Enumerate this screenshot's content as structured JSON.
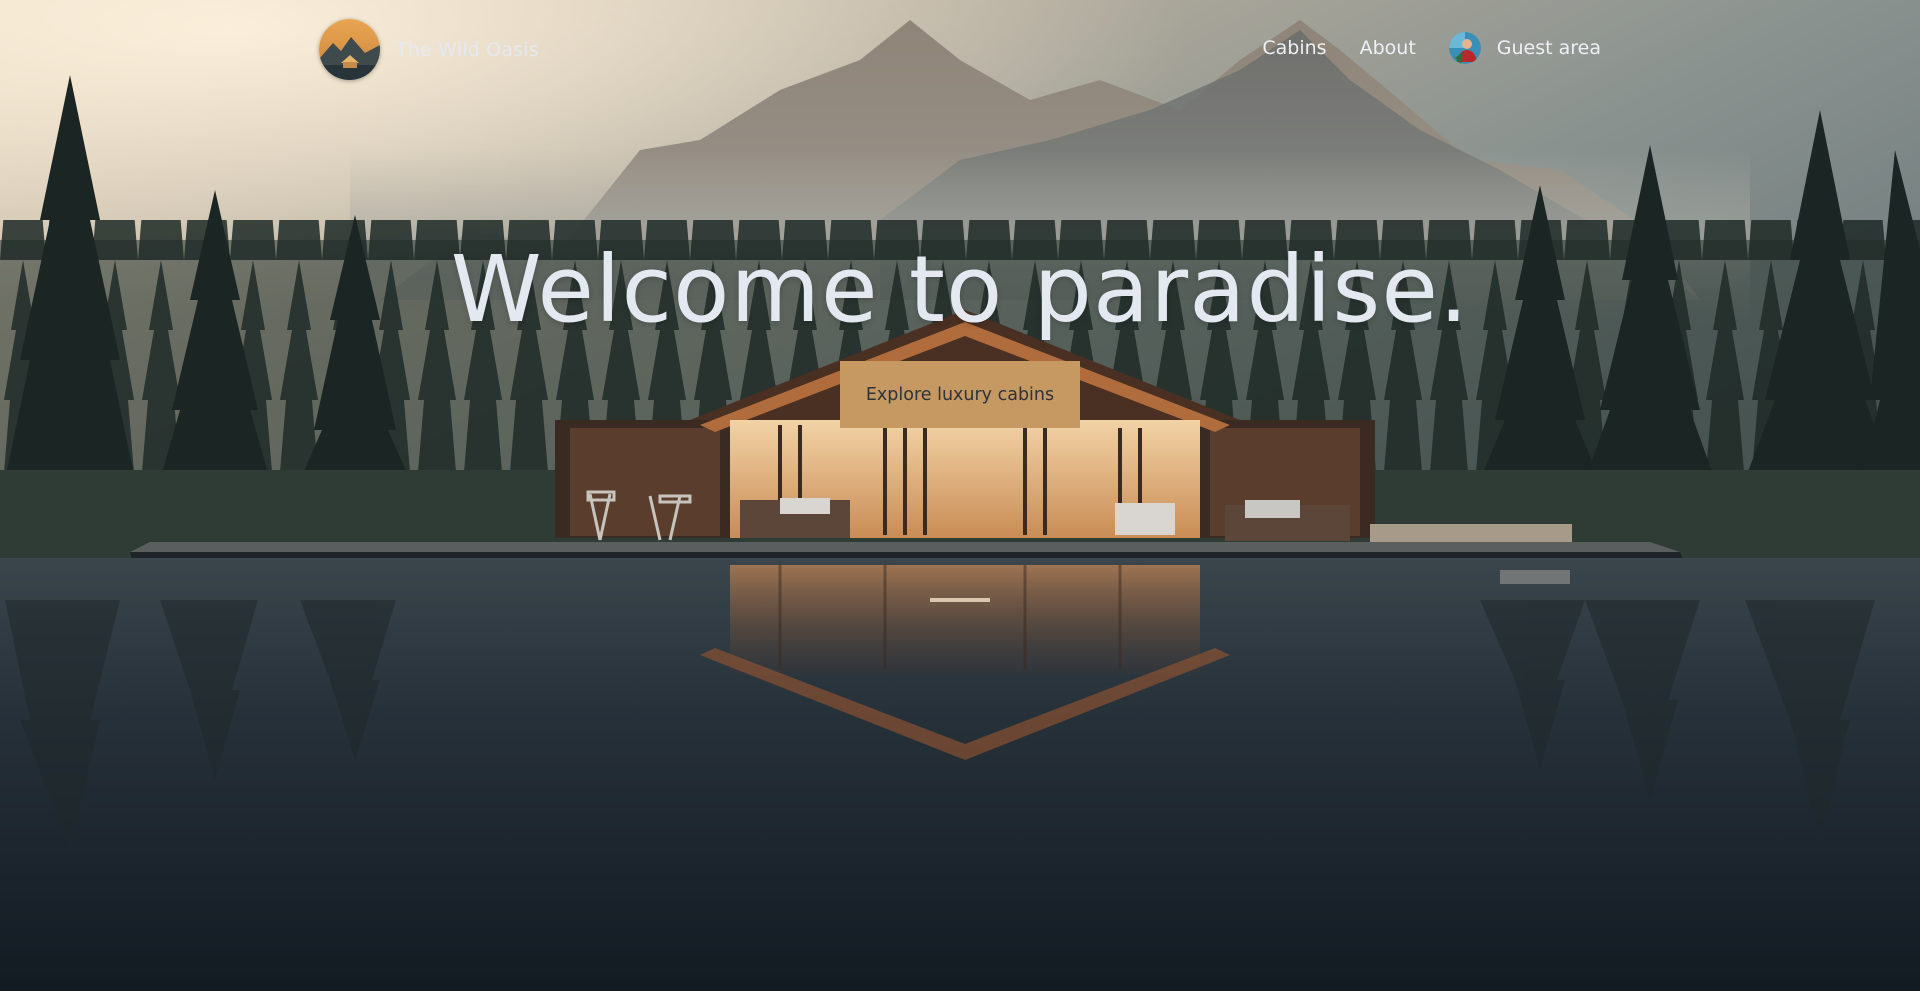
{
  "brand": {
    "name": "The Wild Oasis",
    "logo_icon": "cabin-mountain-logo-icon"
  },
  "nav": {
    "items": [
      {
        "label": "Cabins"
      },
      {
        "label": "About"
      }
    ],
    "guest": {
      "label": "Guest area",
      "avatar_icon": "user-avatar-icon"
    }
  },
  "hero": {
    "title": "Welcome to paradise.",
    "cta_label": "Explore luxury cabins"
  },
  "colors": {
    "accent": "#c69963",
    "text_light": "#e4e8f0",
    "background_dark": "#141c24"
  }
}
